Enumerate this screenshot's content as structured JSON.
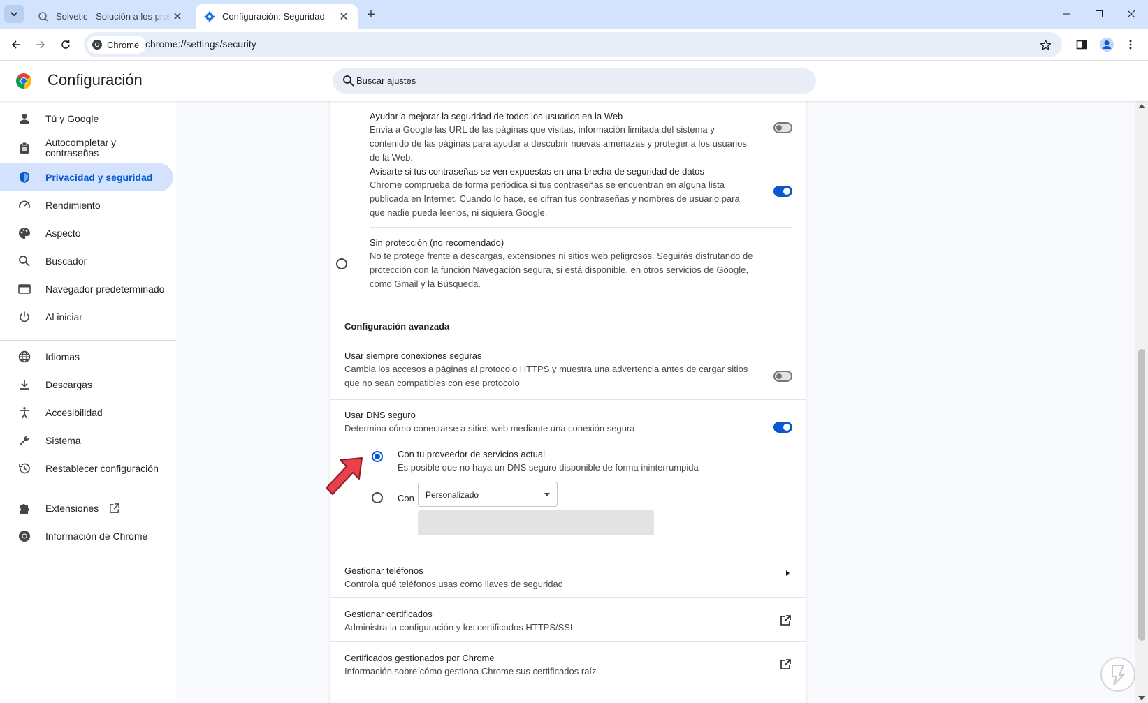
{
  "tabs": [
    {
      "title": "Solvetic - Solución a los problemas",
      "close": "✕"
    },
    {
      "title": "Configuración: Seguridad",
      "close": "✕"
    }
  ],
  "window": {
    "new_tab": "+"
  },
  "toolbar": {
    "chip_label": "Chrome",
    "url": "chrome://settings/security"
  },
  "header": {
    "title": "Configuración",
    "search_placeholder": "Buscar ajustes"
  },
  "sidebar": {
    "items": [
      {
        "label": "Tú y Google",
        "icon": "person-icon"
      },
      {
        "label": "Autocompletar y contraseñas",
        "icon": "clipboard-icon"
      },
      {
        "label": "Privacidad y seguridad",
        "icon": "shield-icon",
        "active": true
      },
      {
        "label": "Rendimiento",
        "icon": "speedometer-icon"
      },
      {
        "label": "Aspecto",
        "icon": "palette-icon"
      },
      {
        "label": "Buscador",
        "icon": "search-icon"
      },
      {
        "label": "Navegador predeterminado",
        "icon": "browser-icon"
      },
      {
        "label": "Al iniciar",
        "icon": "power-icon"
      },
      {
        "label": "Idiomas",
        "icon": "globe-icon"
      },
      {
        "label": "Descargas",
        "icon": "download-icon"
      },
      {
        "label": "Accesibilidad",
        "icon": "accessibility-icon"
      },
      {
        "label": "Sistema",
        "icon": "wrench-icon"
      },
      {
        "label": "Restablecer configuración",
        "icon": "history-icon"
      },
      {
        "label": "Extensiones",
        "icon": "puzzle-icon"
      },
      {
        "label": "Información de Chrome",
        "icon": "chrome-icon"
      }
    ]
  },
  "content": {
    "help_improve": {
      "title": "Ayudar a mejorar la seguridad de todos los usuarios en la Web",
      "description": "Envía a Google las URL de las páginas que visitas, información limitada del sistema y contenido de las páginas para ayudar a descubrir nuevas amenazas y proteger a los usuarios de la Web.",
      "enabled": false
    },
    "password_leak": {
      "title": "Avisarte si tus contraseñas se ven expuestas en una brecha de seguridad de datos",
      "description": "Chrome comprueba de forma periódica si tus contraseñas se encuentran en alguna lista publicada en Internet. Cuando lo hace, se cifran tus contraseñas y nombres de usuario para que nadie pueda leerlos, ni siquiera Google.",
      "enabled": true
    },
    "no_protection": {
      "title": "Sin protección (no recomendado)",
      "description": "No te protege frente a descargas, extensiones ni sitios web peligrosos. Seguirás disfrutando de protección con la función Navegación segura, si está disponible, en otros servicios de Google, como Gmail y la Búsqueda.",
      "selected": false
    },
    "advanced_heading": "Configuración avanzada",
    "https_always": {
      "title": "Usar siempre conexiones seguras",
      "description": "Cambia los accesos a páginas al protocolo HTTPS y muestra una advertencia antes de cargar sitios que no sean compatibles con ese protocolo",
      "enabled": false
    },
    "secure_dns": {
      "title": "Usar DNS seguro",
      "description": "Determina cómo conectarse a sitios web mediante una conexión segura",
      "enabled": true,
      "option_current": {
        "title": "Con tu proveedor de servicios actual",
        "description": "Es posible que no haya un DNS seguro disponible de forma ininterrumpida",
        "selected": true
      },
      "option_custom": {
        "label": "Con",
        "dropdown_value": "Personalizado",
        "selected": false
      }
    },
    "manage_phones": {
      "title": "Gestionar teléfonos",
      "description": "Controla qué teléfonos usas como llaves de seguridad"
    },
    "manage_certs": {
      "title": "Gestionar certificados",
      "description": "Administra la configuración y los certificados HTTPS/SSL"
    },
    "chrome_certs": {
      "title": "Certificados gestionados por Chrome",
      "description": "Información sobre cómo gestiona Chrome sus certificados raíz"
    }
  },
  "colors": {
    "accent": "#0b57d0",
    "active_nav_bg": "#d3e3fd",
    "annotation_arrow": "#e8414b"
  }
}
